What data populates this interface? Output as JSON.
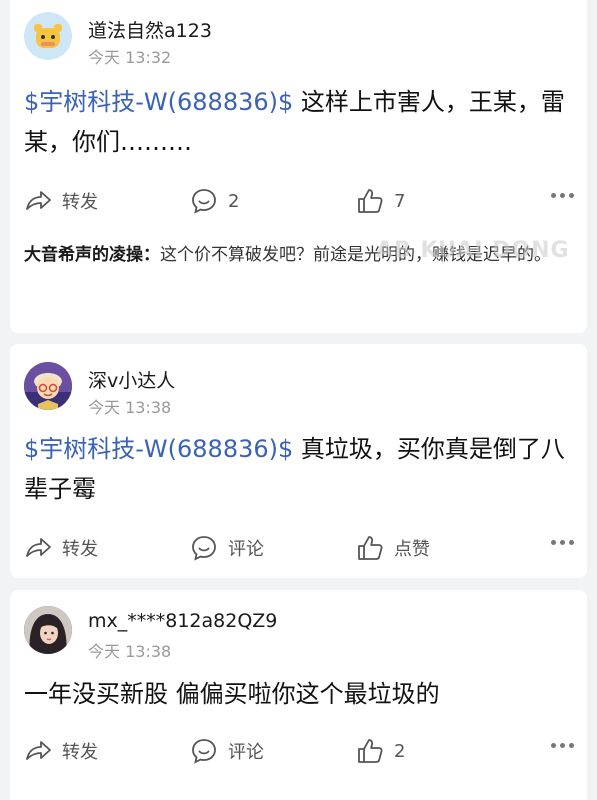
{
  "posts": [
    {
      "username": "道法自然a123",
      "time": "今天 13:32",
      "stock_tag": "$宇树科技-W(688836)$",
      "text": " 这样上市害人，王某，雷某，你们………",
      "actions": {
        "share": "转发",
        "comment": "2",
        "like": "7"
      },
      "reply": {
        "author": "大音希声的凌操：",
        "text": "这个价不算破发吧？前途是光明的，赚钱是迟早的。"
      }
    },
    {
      "username": "深v小达人",
      "time": "今天 13:38",
      "stock_tag": "$宇树科技-W(688836)$",
      "text": " 真垃圾，买你真是倒了八辈子霉",
      "actions": {
        "share": "转发",
        "comment": "评论",
        "like": "点赞"
      }
    },
    {
      "username": "mx_****812a82QZ9",
      "time": "今天 13:38",
      "text": "一年没买新股 偏偏买啦你这个最垃圾的",
      "actions": {
        "share": "转发",
        "comment": "评论",
        "like": "2"
      }
    }
  ],
  "watermark": "AB KUAI DONG"
}
